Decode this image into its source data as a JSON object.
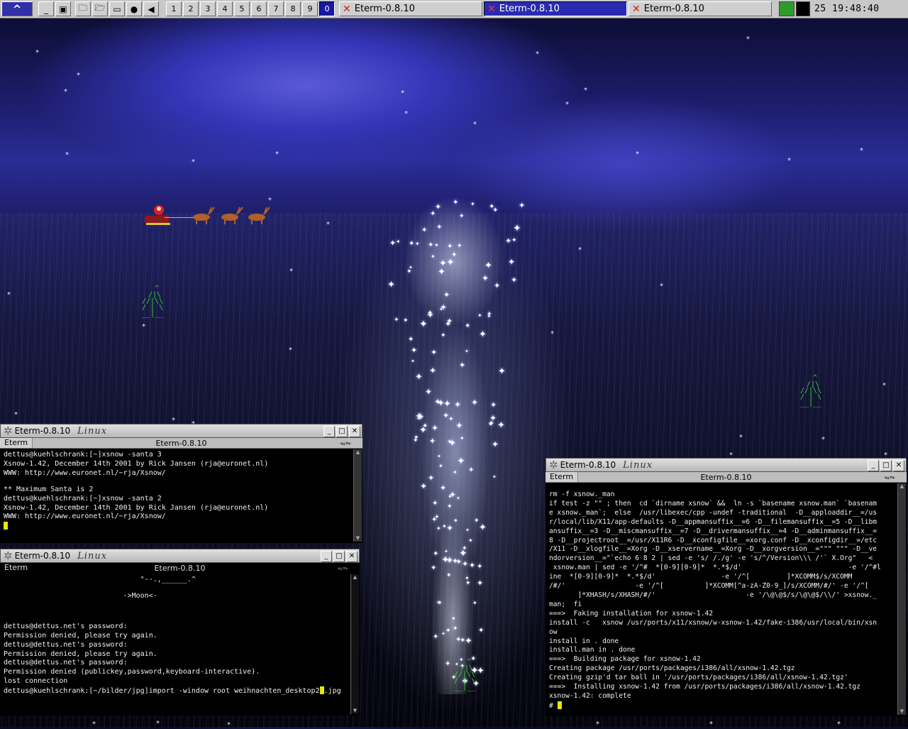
{
  "taskbar": {
    "start_label": "^",
    "icons": [
      "minimize-all-icon",
      "window-list-icon",
      "folder-icon",
      "folder-open-icon",
      "monitor-icon",
      "globe-icon",
      "speaker-icon"
    ],
    "desktops": [
      "1",
      "2",
      "3",
      "4",
      "5",
      "6",
      "7",
      "8",
      "9",
      "0"
    ],
    "active_desktop": "0",
    "tasks": [
      {
        "label": "Eterm-0.8.10",
        "active": false
      },
      {
        "label": "Eterm-0.8.10",
        "active": true
      },
      {
        "label": "Eterm-0.8.10",
        "active": false
      }
    ],
    "clock": "25 19:48:40"
  },
  "windows": {
    "w1": {
      "title": "Eterm-0.8.10",
      "logo": "Linux",
      "menu_label": "Eterm",
      "menu_center": "Eterm-0.8.10",
      "lines": [
        "dettus@kuehlschrank:[~]xsnow -santa 3",
        "Xsnow-1.42, December 14th 2001 by Rick Jansen (rja@euronet.nl)",
        "WWW: http://www.euronet.nl/~rja/Xsnow/",
        "",
        "** Maximum Santa is 2",
        "dettus@kuehlschrank:[~]xsnow -santa 2",
        "Xsnow-1.42, December 14th 2001 by Rick Jansen (rja@euronet.nl)",
        "WWW: http://www.euronet.nl/~rja/Xsnow/"
      ]
    },
    "w2": {
      "title": "Eterm-0.8.10",
      "logo": "Linux",
      "menu_label": "Eterm",
      "menu_center": "Eterm-0.8.10",
      "lines": [
        "                                \"--.,______.^",
        "",
        "                            ->Moon<-",
        "",
        "",
        "",
        "dettus@dettus.net's password:",
        "Permission denied, please try again.",
        "dettus@dettus.net's password:",
        "Permission denied, please try again.",
        "dettus@dettus.net's password:",
        "Permission denied (publickey,password,keyboard-interactive).",
        "lost connection"
      ],
      "prompt": "dettus@kuehlschrank:[~/bilder/jpg]import -window root weihnachten_desktop2",
      "prompt_after": ".jpg"
    },
    "w3": {
      "title": "Eterm-0.8.10",
      "logo": "Linux",
      "menu_label": "Eterm",
      "menu_center": "Eterm-0.8.10",
      "lines": [
        "rm -f xsnow._man",
        "if test -z \"\" ; then  cd `dirname xsnow` &&  ln -s `basename xsnow.man` `basenam",
        "e xsnow._man`;  else  /usr/libexec/cpp -undef -traditional  -D__apploaddir__=/us",
        "r/local/lib/X11/app-defaults -D__appmansuffix__=6 -D__filemansuffix__=5 -D__libm",
        "ansuffix__=3 -D__miscmansuffix__=7 -D__drivermansuffix__=4 -D__adminmansuffix__=",
        "8 -D__projectroot__=/usr/X11R6 -D__xconfigfile__=xorg.conf -D__xconfigdir__=/etc",
        "/X11 -D__xlogfile__=Xorg -D__xservername__=Xorg -D__xorgversion__=\"\"\" \"\"\" -D__ve",
        "ndorversion__=\"`echo 6 8 2 | sed -e 's/ /./g' -e 's/^/Version\\\\\\ /'` X.Org\"   <",
        " xsnow.man | sed -e '/^#  *[0-9][0-9]*  *.*$/d'                          -e '/^#l",
        "ine  *[0-9][0-9]*  *.*$/d'                -e '/^[         ]*XCOMM$/s/XCOMM",
        "/#/'                 -e '/^[          ]*XCOMM[^a-zA-Z0-9_]/s/XCOMM/#/' -e '/^[",
        "       ]*XHASH/s/XHASH/#/'                      -e '/\\@\\@$/s/\\@\\@$/\\\\/' >xsnow._",
        "man;  fi",
        "===>  Faking installation for xsnow-1.42",
        "install -c   xsnow /usr/ports/x11/xsnow/w-xsnow-1.42/fake-i386/usr/local/bin/xsn",
        "ow",
        "install in . done",
        "install.man in . done",
        "===>  Building package for xsnow-1.42",
        "Creating package /usr/ports/packages/i386/all/xsnow-1.42.tgz",
        "Creating gzip'd tar ball in '/usr/ports/packages/i386/all/xsnow-1.42.tgz'",
        "===>  Installing xsnow-1.42 from /usr/ports/packages/i386/all/xsnow-1.42.tgz",
        "xsnow-1.42: complete"
      ],
      "prompt": "# "
    }
  }
}
